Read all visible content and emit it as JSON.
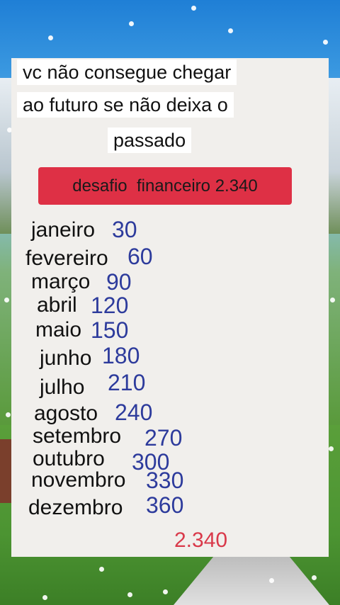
{
  "title_lines": [
    "vc não consegue chegar",
    "ao futuro se não deixa o",
    "passado"
  ],
  "badge": "desafio  financeiro 2.340",
  "months": [
    {
      "name": "janeiro",
      "value": "30"
    },
    {
      "name": "fevereiro",
      "value": "60"
    },
    {
      "name": "março",
      "value": "90"
    },
    {
      "name": "abril",
      "value": "120"
    },
    {
      "name": "maio",
      "value": "150"
    },
    {
      "name": "junho",
      "value": "180"
    },
    {
      "name": "julho",
      "value": "210"
    },
    {
      "name": "agosto",
      "value": "240"
    },
    {
      "name": "setembro",
      "value": "270"
    },
    {
      "name": "outubro",
      "value": "300"
    },
    {
      "name": "novembro",
      "value": "330"
    },
    {
      "name": "dezembro",
      "value": "360"
    }
  ],
  "total": "2.340",
  "colors": {
    "badge": "#de3045",
    "amount": "#2d3b9c",
    "total": "#d9394a"
  }
}
